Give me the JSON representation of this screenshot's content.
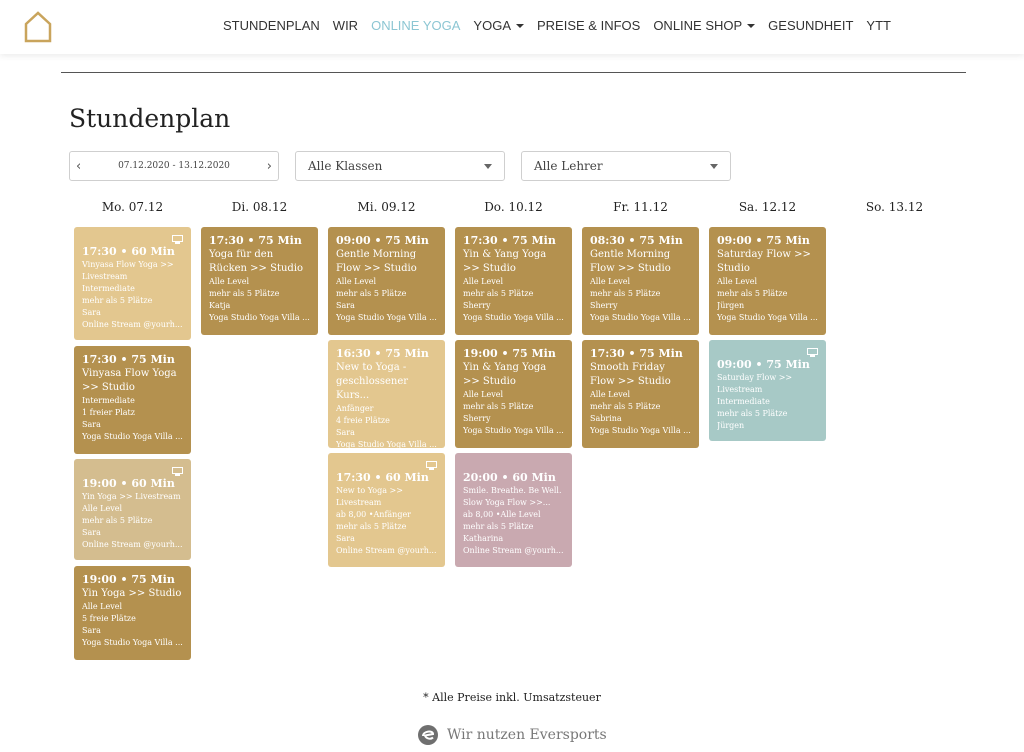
{
  "nav": {
    "items": [
      {
        "label": "STUNDENPLAN"
      },
      {
        "label": "WIR"
      },
      {
        "label": "ONLINE YOGA"
      },
      {
        "label": "YOGA"
      },
      {
        "label": "PREISE & INFOS"
      },
      {
        "label": "ONLINE SHOP"
      },
      {
        "label": "GESUNDHEIT"
      },
      {
        "label": "YTT"
      }
    ],
    "active_color": "#8cc6d3"
  },
  "page": {
    "title": "Stundenplan"
  },
  "filters": {
    "date_range": "07.12.2020 - 13.12.2020",
    "prev_icon": "‹",
    "next_icon": "›",
    "classes": "Alle Klassen",
    "teachers": "Alle Lehrer"
  },
  "days": [
    {
      "label": "Mo. 07.12"
    },
    {
      "label": "Di. 08.12"
    },
    {
      "label": "Mi. 09.12"
    },
    {
      "label": "Do. 10.12"
    },
    {
      "label": "Fr. 11.12"
    },
    {
      "label": "Sa. 12.12"
    },
    {
      "label": "So. 13.12"
    }
  ],
  "cards": {
    "mo1": {
      "time": "17:30 • 60 Min",
      "name": "Vinyasa Flow Yoga >> Livestream",
      "level": "Intermediate",
      "spots": "mehr als 5 Plätze",
      "teacher": "Sara",
      "location": "Online Stream @yourh..."
    },
    "mo2": {
      "time": "17:30 • 75 Min",
      "name": "Vinyasa Flow Yoga >> Studio",
      "level": "Intermediate",
      "spots": "1 freier Platz",
      "teacher": "Sara",
      "location": "Yoga Studio Yoga Villa ..."
    },
    "mo3": {
      "time": "19:00 • 60 Min",
      "name": "Yin Yoga >> Livestream",
      "level": "Alle Level",
      "spots": "mehr als 5 Plätze",
      "teacher": "Sara",
      "location": "Online Stream @yourh..."
    },
    "mo4": {
      "time": "19:00 • 75 Min",
      "name": "Yin Yoga >> Studio",
      "level": "Alle Level",
      "spots": "5 freie Plätze",
      "teacher": "Sara",
      "location": "Yoga Studio Yoga Villa ..."
    },
    "di1": {
      "time": "17:30 • 75 Min",
      "name": "Yoga für den Rücken >> Studio",
      "level": "Alle Level",
      "spots": "mehr als 5 Plätze",
      "teacher": "Katja",
      "location": "Yoga Studio Yoga Villa ..."
    },
    "mi1": {
      "time": "09:00 • 75 Min",
      "name": "Gentle Morning Flow >> Studio",
      "level": "Alle Level",
      "spots": "mehr als 5 Plätze",
      "teacher": "Sara",
      "location": "Yoga Studio Yoga Villa ..."
    },
    "mi2": {
      "time": "16:30 • 75 Min",
      "name": "New to Yoga - geschlossener Kurs...",
      "level": "Anfänger",
      "spots": "4 freie Plätze",
      "teacher": "Sara",
      "location": "Yoga Studio Yoga Villa ..."
    },
    "mi3": {
      "time": "17:30 • 60 Min",
      "name": "New to Yoga >> Livestream",
      "level": "ab 8,00 •Anfänger",
      "spots": "mehr als 5 Plätze",
      "teacher": "Sara",
      "location": "Online Stream @yourh..."
    },
    "do1": {
      "time": "17:30 • 75 Min",
      "name": "Yin & Yang Yoga >> Studio",
      "level": "Alle Level",
      "spots": "mehr als 5 Plätze",
      "teacher": "Sherry",
      "location": "Yoga Studio Yoga Villa ..."
    },
    "do2": {
      "time": "19:00 • 75 Min",
      "name": "Yin & Yang Yoga >> Studio",
      "level": "Alle Level",
      "spots": "mehr als 5 Plätze",
      "teacher": "Sherry",
      "location": "Yoga Studio Yoga Villa ..."
    },
    "do3": {
      "time": "20:00 • 60 Min",
      "name": "Smile. Breathe. Be Well. Slow Yoga Flow >>...",
      "level": "ab 8,00 •Alle Level",
      "spots": "mehr als 5 Plätze",
      "teacher": "Katharina",
      "location": "Online Stream @yourh..."
    },
    "fr1": {
      "time": "08:30 • 75 Min",
      "name": "Gentle Morning Flow >> Studio",
      "level": "Alle Level",
      "spots": "mehr als 5 Plätze",
      "teacher": "Sherry",
      "location": "Yoga Studio Yoga Villa ..."
    },
    "fr2": {
      "time": "17:30 • 75 Min",
      "name": "Smooth Friday Flow >> Studio",
      "level": "Alle Level",
      "spots": "mehr als 5 Plätze",
      "teacher": "Sabrina",
      "location": "Yoga Studio Yoga Villa ..."
    },
    "sa1": {
      "time": "09:00 • 75 Min",
      "name": "Saturday Flow >> Studio",
      "level": "Alle Level",
      "spots": "mehr als 5 Plätze",
      "teacher": "Jürgen",
      "location": "Yoga Studio Yoga Villa ..."
    },
    "sa2": {
      "time": "09:00 • 75 Min",
      "name": "Saturday Flow >> Livestream",
      "level": "Intermediate",
      "spots": "mehr als 5 Plätze",
      "teacher": "Jürgen"
    }
  },
  "colors": {
    "gold": "#b4914f",
    "light_gold": "#e3c78f",
    "beige": "#d4bd8f",
    "teal": "#a7c9c6",
    "mauve": "#c9a9b0"
  },
  "footer": {
    "note": "* Alle Preise inkl. Umsatzsteuer",
    "powered_by": "Wir nutzen Eversports"
  }
}
